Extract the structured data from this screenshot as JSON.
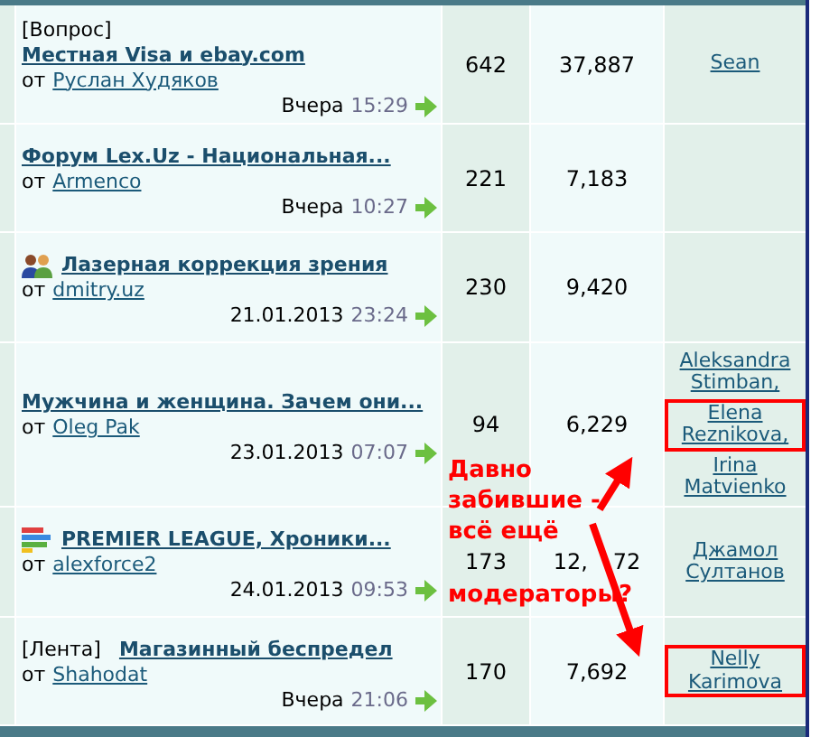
{
  "topics": [
    {
      "kind": "question",
      "prefix": "[Вопрос]",
      "title": "Местная Visa и ebay.com",
      "author_label": "от",
      "author": "Руслан Худяков",
      "date": "Вчера",
      "time": "15:29",
      "replies": "642",
      "views": [
        "37,887"
      ],
      "moderators": [
        {
          "name": "Sean",
          "highlighted": false
        }
      ]
    },
    {
      "kind": "plain",
      "title": "Форум Lex.Uz - Национальная...",
      "author_label": "от",
      "author": "Armenco",
      "date": "Вчера",
      "time": "10:27",
      "replies": "221",
      "views": [
        "7,183"
      ]
    },
    {
      "kind": "people",
      "title": "Лазерная коррекция зрения",
      "author_label": "от",
      "author": "dmitry.uz",
      "date": "21.01.2013",
      "time": "23:24",
      "replies": "230",
      "views": [
        "9,420"
      ]
    },
    {
      "kind": "plain",
      "title": "Мужчина и женщина. Зачем они...",
      "author_label": "от",
      "author": "Oleg Pak",
      "date": "23.01.2013",
      "time": "07:07",
      "replies": "94",
      "views": [
        "6,229"
      ],
      "moderators": [
        {
          "name": "Aleksandra Stimban,",
          "highlighted": false
        },
        {
          "name": "Elena Reznikova,",
          "highlighted": true
        },
        {
          "name": "Irina Matvienko",
          "highlighted": false
        }
      ]
    },
    {
      "kind": "bars",
      "title": "PREMIER LEAGUE, Хроники...",
      "author_label": "от",
      "author": "alexforce2",
      "date": "24.01.2013",
      "time": "09:53",
      "replies": "173",
      "views": [
        "12,",
        "72"
      ],
      "moderators": [
        {
          "name": "Джамол Султанов",
          "highlighted": false
        }
      ]
    },
    {
      "kind": "feed",
      "prefix": "[Лента]",
      "title": "Магазинный беспредел",
      "author_label": "от",
      "author": "Shahodat",
      "date": "Вчера",
      "time": "21:06",
      "replies": "170",
      "views": [
        "7,692"
      ],
      "moderators": [
        {
          "name": "Nelly Karimova",
          "highlighted": true
        }
      ]
    }
  ],
  "annotation": {
    "lines": [
      "Давно",
      "забившие -",
      "всё ещё",
      "модераторы?"
    ]
  }
}
